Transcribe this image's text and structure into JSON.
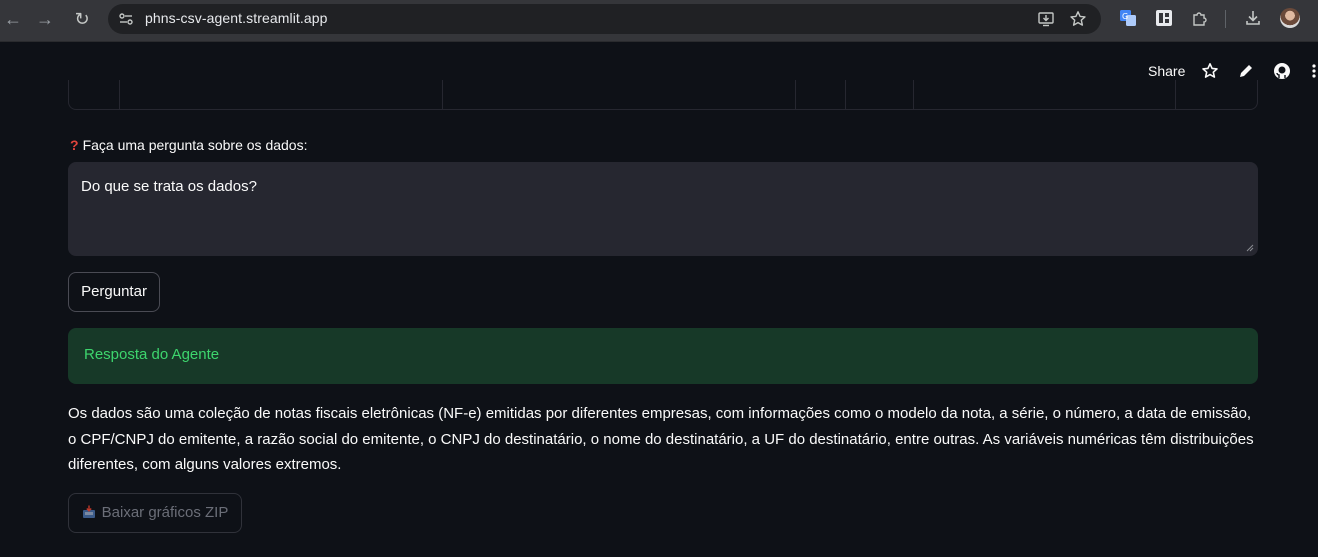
{
  "browser": {
    "url": "phns-csv-agent.streamlit.app"
  },
  "toolbar": {
    "share_label": "Share"
  },
  "question": {
    "label": "Faça uma pergunta sobre os dados:",
    "label_icon": "question-mark-icon",
    "value": "Do que se trata os dados?"
  },
  "ask_button": {
    "label": "Perguntar"
  },
  "response": {
    "header": "Resposta do Agente",
    "accent": "#3dd56d",
    "text": "Os dados são uma coleção de notas fiscais eletrônicas (NF-e) emitidas por diferentes empresas, com informações como o modelo da nota, a série, o número, a data de emissão, o CPF/CNPJ do emitente, a razão social do emitente, o CNPJ do destinatário, o nome do destinatário, a UF do destinatário, entre outras. As variáveis numéricas têm distribuições diferentes, com alguns valores extremos."
  },
  "download_button": {
    "label": "Baixar gráficos ZIP",
    "icon": "inbox-tray-icon"
  }
}
